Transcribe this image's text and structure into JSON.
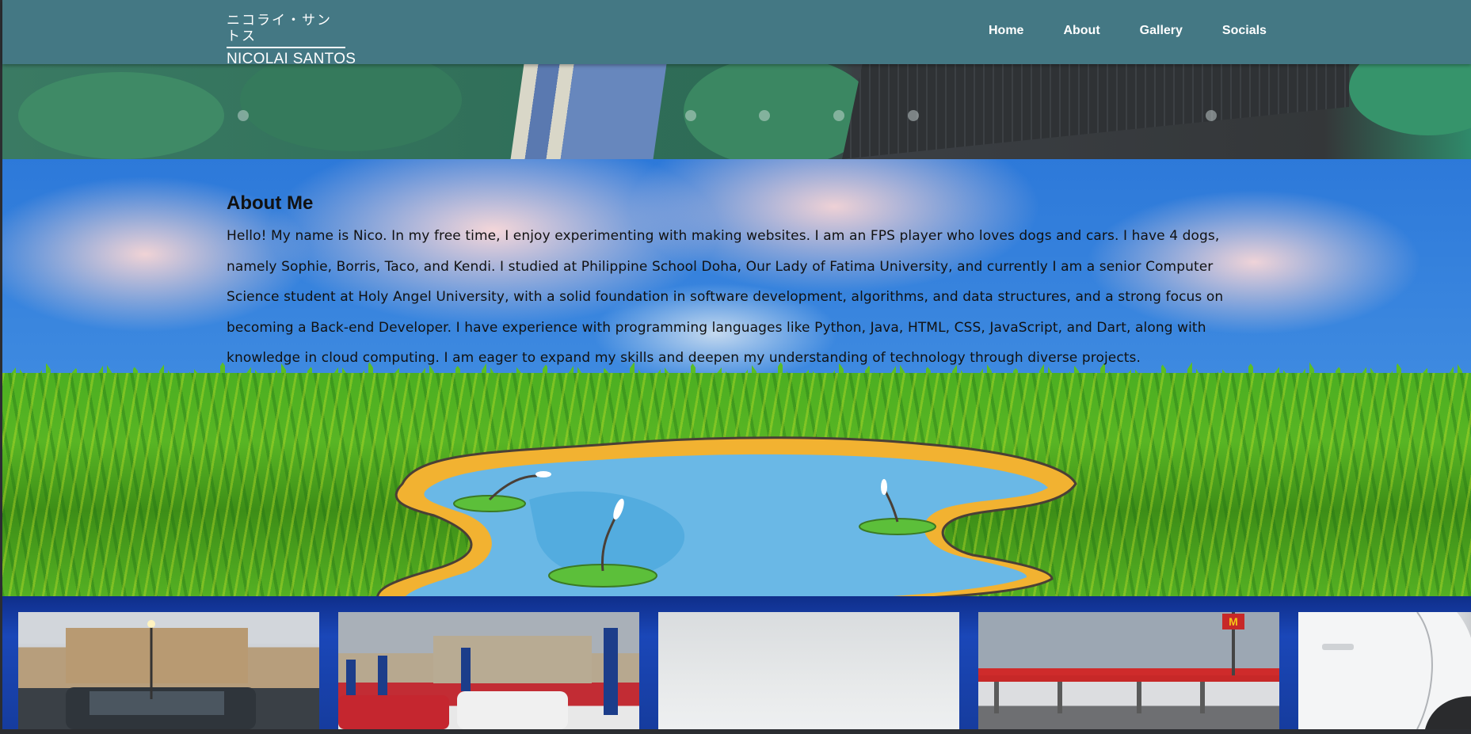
{
  "header": {
    "logo_jp": "ニコライ・サントス",
    "logo_en": "NICOLAI SANTOS",
    "nav": [
      {
        "label": "Home"
      },
      {
        "label": "About"
      },
      {
        "label": "Gallery"
      },
      {
        "label": "Socials"
      }
    ]
  },
  "about": {
    "title": "About Me",
    "body": "Hello! My name is Nico. In my free time, I enjoy experimenting with making websites. I am an FPS player who loves dogs and cars. I have 4 dogs, namely Sophie, Borris, Taco, and Kendi. I studied at Philippine School Doha, Our Lady of Fatima University, and currently I am a senior Computer Science student at Holy Angel University, with a solid foundation in software development, algorithms, and data structures, and a strong focus on becoming a Back-end Developer. I have experience with programming languages like Python, Java, HTML, CSS, JavaScript, and Dart, along with knowledge in cloud computing. I am eager to expand my skills and deepen my understanding of technology through diverse projects."
  },
  "colors": {
    "header_bg": "#447884",
    "gallery_bg": "#1a47b8",
    "text": "#111111"
  }
}
